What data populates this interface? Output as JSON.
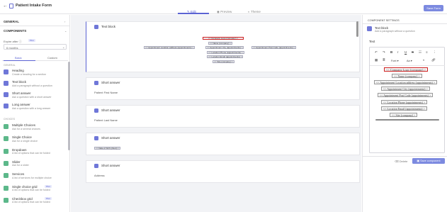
{
  "app": {
    "back_icon": "back-arrow-icon",
    "doc_icon": "document-icon",
    "title": "Patient Intake Form",
    "tabs": [
      "Edit",
      "Preview",
      "Theme"
    ],
    "save_label": "Save Form",
    "accent": "#5b63d3"
  },
  "sidebar": {
    "general": "GENERAL",
    "components": "COMPONENTS",
    "expire_label": "Expire after",
    "expire_badge": "Plus",
    "expire_value": "6 months",
    "tabs": [
      "Basic",
      "Custom"
    ],
    "category_general": "GENERAL",
    "category_choices": "CHOICES",
    "items": [
      {
        "label": "Heading",
        "desc": "Create a heading for a section",
        "icon": "heading-icon",
        "color": "#6f77d8"
      },
      {
        "label": "Text block",
        "desc": "Add a paragraph without a question",
        "icon": "text-block-icon",
        "color": "#6f77d8"
      },
      {
        "label": "Short answer",
        "desc": "Ask a question with a short answer",
        "icon": "short-answer-icon",
        "color": "#6f77d8"
      },
      {
        "label": "Long answer",
        "desc": "Ask a question with a long answer",
        "icon": "long-answer-icon",
        "color": "#6f77d8"
      }
    ],
    "choice_items": [
      {
        "label": "Multiple Choices",
        "desc": "Ask for a several choices",
        "icon": "multiple-choice-icon",
        "color": "#5cb88a",
        "badge": ""
      },
      {
        "label": "Single Choice",
        "desc": "Ask for a single choice",
        "icon": "single-choice-icon",
        "color": "#5cb88a",
        "badge": ""
      },
      {
        "label": "Dropdown",
        "desc": "A list of options that can be folded",
        "icon": "dropdown-icon",
        "color": "#5cb88a",
        "badge": ""
      },
      {
        "label": "Slider",
        "desc": "Ask for a slider",
        "icon": "slider-icon",
        "color": "#5cb88a",
        "badge": ""
      },
      {
        "label": "Services",
        "desc": "A list of services for multiple choice",
        "icon": "services-icon",
        "color": "#5cb88a",
        "badge": ""
      },
      {
        "label": "Single choice grid",
        "desc": "A list of options that can be folded",
        "icon": "grid-icon",
        "color": "#5cb88a",
        "badge": "Plus"
      },
      {
        "label": "Checkbox grid",
        "desc": "A list of options that can be folded",
        "icon": "checkbox-grid-icon",
        "color": "#5cb88a",
        "badge": "Plus"
      }
    ]
  },
  "canvas": {
    "text_block_label": "Text block",
    "chips": [
      "<< Company Logo (company) >",
      "<< Name (company) >",
      "<< Appointment Location address (appointments) >",
      "<< Appointment City (appointments) >",
      "<< Appointment Post Code (appointments) >",
      "<< Location Phone (appointments) >",
      "<< Location Email (appointments) >",
      "<< Site (company) >"
    ],
    "cards": [
      {
        "label": "Short answer",
        "value": "Patient First Name"
      },
      {
        "label": "Short answer",
        "value": "Patient Last Name"
      },
      {
        "label": "Short answer",
        "value": "<< Date of birth (client) >"
      },
      {
        "label": "Short answer",
        "value": "Address"
      }
    ]
  },
  "panel": {
    "title": "COMPONENT SETTINGS",
    "comp_name": "Text block",
    "comp_desc": "Add a paragraph without a question",
    "text_label": "Text",
    "font_label": "Font",
    "size_label": "Aa",
    "tags": [
      "<< Company Logo (company) >",
      "<< Name (company) >",
      "<< Appointment Location address (appointments) >",
      "<< Appointment City (appointments) >",
      "<< Appointment Post Code (appointments) >",
      "<< Location Phone (appointments) >",
      "<< Location Email (appointments) >",
      "<< Site (company) >"
    ],
    "delete_label": "Delete",
    "save_label": "Save component"
  }
}
